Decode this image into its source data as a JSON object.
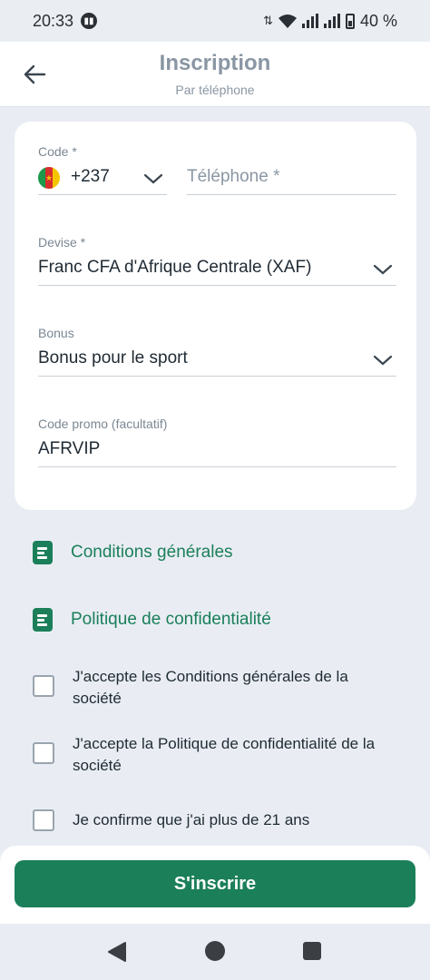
{
  "status_bar": {
    "time": "20:33",
    "battery": "40 %"
  },
  "header": {
    "title": "Inscription",
    "subtitle": "Par téléphone"
  },
  "form": {
    "code": {
      "label": "Code *",
      "value": "+237"
    },
    "phone": {
      "placeholder": "Téléphone *"
    },
    "currency": {
      "label": "Devise *",
      "value": "Franc CFA d'Afrique Centrale (XAF)"
    },
    "bonus": {
      "label": "Bonus",
      "value": "Bonus pour le sport"
    },
    "promo": {
      "label": "Code promo (facultatif)",
      "value": "AFRVIP"
    }
  },
  "links": [
    {
      "label": "Conditions générales",
      "icon": "document-icon"
    },
    {
      "label": "Politique de confidentialité",
      "icon": "document-icon"
    }
  ],
  "checkboxes": [
    {
      "label": "J'accepte les Conditions générales de la société",
      "checked": false
    },
    {
      "label": "J'accepte la Politique de confidentialité de la société",
      "checked": false
    },
    {
      "label": "Je confirme que j'ai plus de 21 ans",
      "checked": false
    }
  ],
  "submit": {
    "label": "S'inscrire"
  },
  "colors": {
    "accent": "#1b7f5a",
    "background": "#e9edf3",
    "muted": "#8a96a3"
  }
}
